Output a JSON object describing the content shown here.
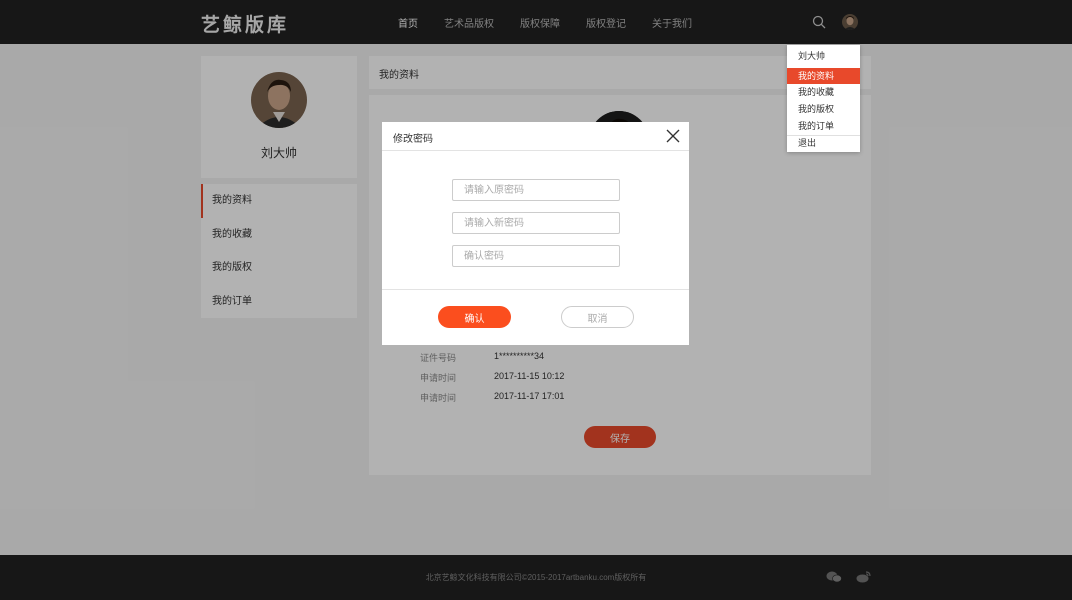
{
  "header": {
    "logo": "艺鲸版库",
    "nav": [
      "首页",
      "艺术品版权",
      "版权保障",
      "版权登记",
      "关于我们"
    ]
  },
  "sidebar": {
    "user_name": "刘大帅",
    "menu": [
      "我的资料",
      "我的收藏",
      "我的版权",
      "我的订单"
    ]
  },
  "content": {
    "title": "我的资料",
    "rows": [
      {
        "label": "证件号码",
        "value": "1**********34"
      },
      {
        "label": "申请时间",
        "value": "2017-11-15 10:12"
      },
      {
        "label": "申请时间",
        "value": "2017-11-17 17:01"
      }
    ],
    "save_label": "保存"
  },
  "dropdown": {
    "user_name": "刘大帅",
    "items": [
      "我的资料",
      "我的收藏",
      "我的版权",
      "我的订单"
    ],
    "logout": "退出"
  },
  "modal": {
    "title": "修改密码",
    "old_placeholder": "请输入原密码",
    "new_placeholder": "请输入新密码",
    "confirm_placeholder": "确认密码",
    "confirm_label": "确认",
    "cancel_label": "取消"
  },
  "footer": {
    "copyright": "北京艺鲸文化科技有限公司©2015-2017artbanku.com版权所有"
  },
  "colors": {
    "accent": "#e8492b",
    "header_bg": "#222222",
    "page_bg": "#f3f3f3"
  }
}
